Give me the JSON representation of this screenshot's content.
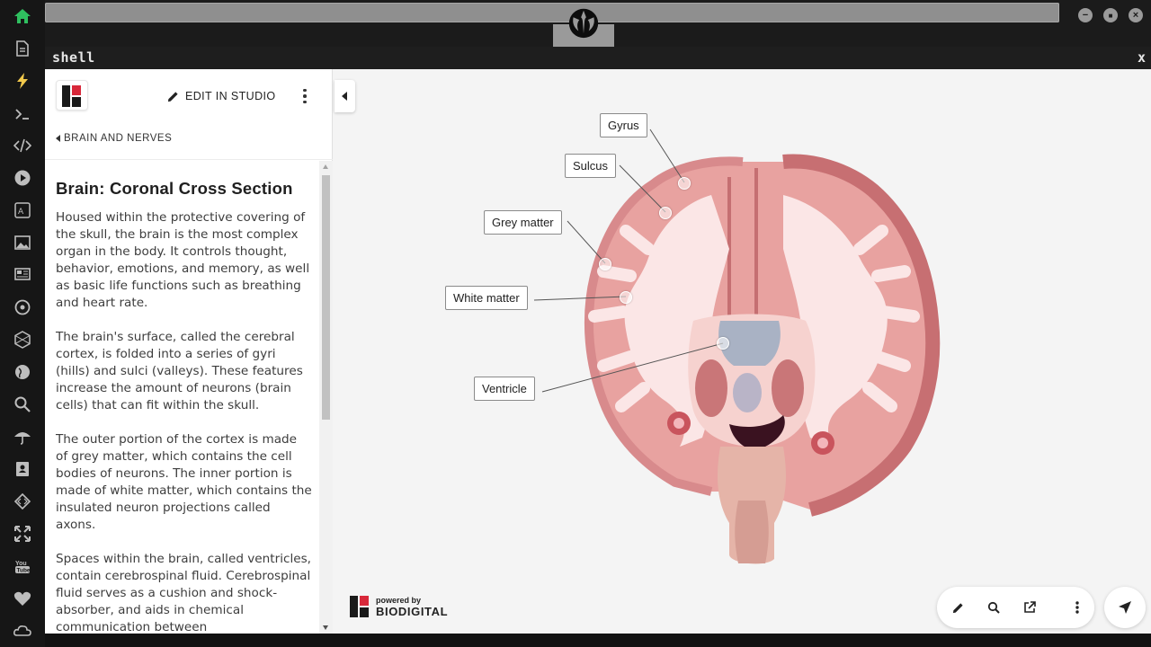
{
  "colors": {
    "accent_green": "#2fbf5f",
    "accent_yellow": "#f2c94c",
    "brand_red": "#d8283a",
    "brand_black": "#1a1a1a"
  },
  "dock": {
    "items": [
      {
        "icon": "home-icon",
        "active": true
      },
      {
        "icon": "document-icon"
      },
      {
        "icon": "lightning-icon"
      },
      {
        "icon": "terminal-icon"
      },
      {
        "icon": "code-icon"
      },
      {
        "icon": "play-icon"
      },
      {
        "icon": "translate-icon"
      },
      {
        "icon": "image-icon"
      },
      {
        "icon": "news-icon"
      },
      {
        "icon": "settings-icon"
      },
      {
        "icon": "hexagon-icon"
      },
      {
        "icon": "globe-icon"
      },
      {
        "icon": "search-icon"
      },
      {
        "icon": "umbrella-icon"
      },
      {
        "icon": "contact-icon"
      },
      {
        "icon": "diamond-code-icon"
      },
      {
        "icon": "expand-icon"
      },
      {
        "icon": "youtube-icon"
      },
      {
        "icon": "heart-icon"
      },
      {
        "icon": "cloud-icon"
      }
    ]
  },
  "window": {
    "minimize": "−",
    "maximize": "■",
    "close": "×"
  },
  "shell": {
    "title": "shell",
    "close": "x"
  },
  "panel": {
    "edit_label": "EDIT IN STUDIO",
    "breadcrumb": "BRAIN AND NERVES",
    "title": "Brain: Coronal Cross Section",
    "paragraphs": [
      "Housed within the protective covering of the skull, the brain is the most complex organ in the body. It controls thought, behavior, emotions, and memory, as well as basic life functions such as breathing and heart rate.",
      "The brain's surface, called the cerebral cortex, is folded into a series of gyri (hills) and sulci (valleys). These features increase the amount of neurons (brain cells) that can fit within the skull.",
      "The outer portion of the cortex is made of grey matter, which contains the cell bodies of neurons. The inner portion is made of white matter, which contains the insulated neuron projections called axons.",
      "Spaces within the brain, called ventricles, contain cerebrospinal fluid. Cerebrospinal fluid serves as a cushion and shock-absorber, and aids in chemical communication between"
    ]
  },
  "viewer": {
    "labels": [
      "Gyrus",
      "Sulcus",
      "Grey matter",
      "White matter",
      "Ventricle"
    ],
    "powered_by": "powered by",
    "brand": "BIODIGITAL",
    "toolbar": [
      "pencil-icon",
      "search-icon",
      "external-link-icon",
      "more-icon"
    ],
    "nav_icon": "navigate-icon"
  }
}
